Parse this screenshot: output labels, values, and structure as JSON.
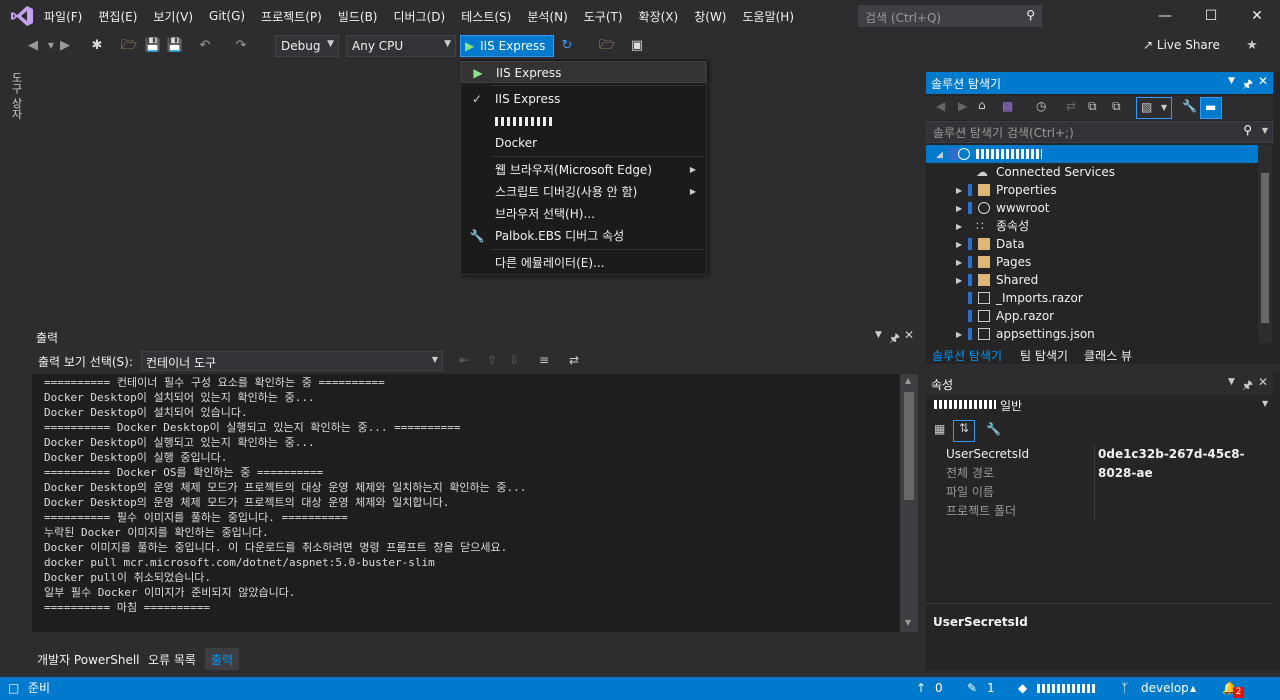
{
  "menu": [
    "파일(F)",
    "편집(E)",
    "보기(V)",
    "Git(G)",
    "프로젝트(P)",
    "빌드(B)",
    "디버그(D)",
    "테스트(S)",
    "분석(N)",
    "도구(T)",
    "확장(X)",
    "창(W)",
    "도움말(H)"
  ],
  "search": {
    "placeholder": "검색 (Ctrl+Q)"
  },
  "toolbar": {
    "config": "Debug",
    "platform": "Any CPU",
    "run_target": "IIS Express",
    "live_share": "Live Share"
  },
  "left_strip": "도구 상자",
  "run_menu": {
    "items": [
      "IIS Express",
      "IIS Express",
      "Docker",
      "웹 브라우저(Microsoft Edge)",
      "스크립트 디버깅(사용 안 함)",
      "브라우저 선택(H)...",
      "Palbok.EBS 디버그 속성",
      "다른 에뮬레이터(E)..."
    ]
  },
  "output": {
    "title": "출력",
    "source_label": "출력 보기 선택(S):",
    "source_value": "컨테이너 도구",
    "lines": [
      "========== 컨테이너 필수 구성 요소를 확인하는 중 ==========",
      "Docker Desktop이 설치되어 있는지 확인하는 중...",
      "Docker Desktop이 설치되어 있습니다.",
      "========== Docker Desktop이 실행되고 있는지 확인하는 중... ==========",
      "Docker Desktop이 실행되고 있는지 확인하는 중...",
      "Docker Desktop이 실행 중입니다.",
      "========== Docker OS를 확인하는 중 ==========",
      "Docker Desktop의 운영 체제 모드가 프로젝트의 대상 운영 체제와 일치하는지 확인하는 중...",
      "Docker Desktop의 운영 체제 모드가 프로젝트의 대상 운영 체제와 일치합니다.",
      "========== 필수 이미지를 풀하는 중입니다. ==========",
      "누락된 Docker 이미지를 확인하는 중입니다.",
      "Docker 이미지를 풀하는 중입니다. 이 다운로드를 취소하려면 명령 프롬프트 창을 닫으세요.",
      "docker pull mcr.microsoft.com/dotnet/aspnet:5.0-buster-slim",
      "Docker pull이 취소되었습니다.",
      "일부 필수 Docker 이미지가 준비되지 않았습니다.",
      "========== 마침 =========="
    ]
  },
  "bottom_tabs": [
    "개발자 PowerShell",
    "오류 목록",
    "출력"
  ],
  "solution_explorer": {
    "title": "솔루션 탐색기",
    "search_placeholder": "솔루션 탐색기 검색(Ctrl+;)",
    "items": [
      "Connected Services",
      "Properties",
      "wwwroot",
      "종속성",
      "Data",
      "Pages",
      "Shared",
      "_Imports.razor",
      "App.razor",
      "appsettings.json"
    ],
    "tabs": [
      "솔루션 탐색기",
      "팀 탐색기",
      "클래스 뷰"
    ]
  },
  "properties": {
    "title": "속성",
    "header_suffix": "일반",
    "rows": [
      {
        "name": "UserSecretsId",
        "value": "0de1c32b-267d-45c8-8028-ae"
      },
      {
        "name": "전체 경로",
        "value": ""
      },
      {
        "name": "파일 이름",
        "value": ""
      },
      {
        "name": "프로젝트 폴더",
        "value": ""
      }
    ],
    "desc_title": "UserSecretsId"
  },
  "status": {
    "ready": "준비",
    "up": "0",
    "edits": "1",
    "branch": "develop",
    "notif": "2"
  },
  "colors": {
    "accent": "#007acc",
    "bg": "#2d2d30",
    "editor": "#1e1e1e"
  }
}
